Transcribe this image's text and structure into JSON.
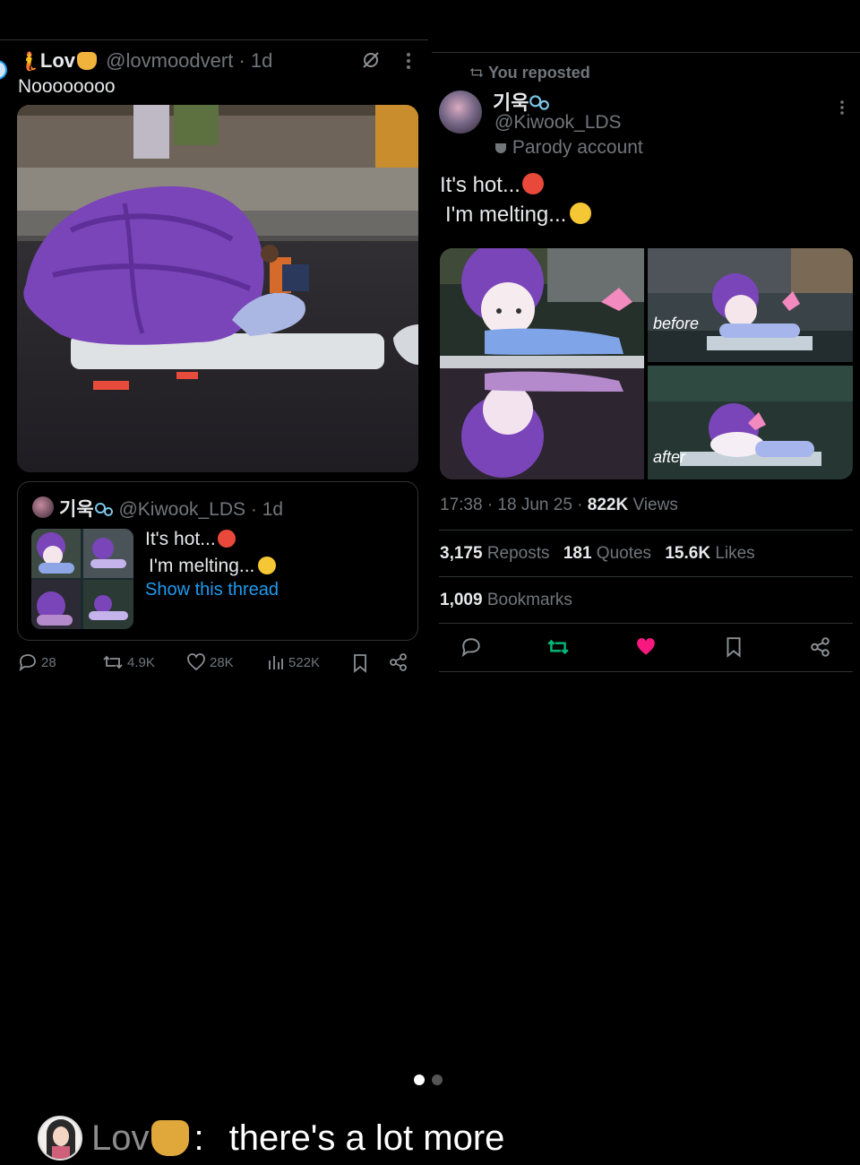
{
  "left_tweet": {
    "display_name": "Lov",
    "handle": "@lovmoodvert",
    "time": "1d",
    "text": "Noooooooo",
    "quote": {
      "display_name": "기욱",
      "handle": "@Kiwook_LDS",
      "time": "1d",
      "line1": "It's hot...",
      "line2": "I'm melting...",
      "show_thread": "Show this thread"
    },
    "stats": {
      "replies": "28",
      "reposts": "4.9K",
      "likes": "28K",
      "views": "522K"
    }
  },
  "right_tweet": {
    "reposted_label": "You reposted",
    "display_name": "기욱",
    "handle": "@Kiwook_LDS",
    "parody_label": "Parody account",
    "line1": "It's hot...",
    "line2": "I'm melting...",
    "image_labels": {
      "before": "before",
      "after": "after"
    },
    "timestamp": "17:38 · 18 Jun 25 · ",
    "views_value": "822K",
    "views_label": "Views",
    "reposts_value": "3,175",
    "reposts_label": "Reposts",
    "quotes_value": "181",
    "quotes_label": "Quotes",
    "likes_value": "15.6K",
    "likes_label": "Likes",
    "bookmarks_value": "1,009",
    "bookmarks_label": "Bookmarks"
  },
  "caption": {
    "name": "Lov",
    "sep": ":",
    "text": "there's a lot more"
  },
  "pager": {
    "current_page": 1,
    "total_pages": 2
  },
  "colors": {
    "bg": "#000000",
    "text": "#e7e9ea",
    "muted": "#71767b",
    "link": "#1d9bf0",
    "repost_active": "#00ba7c",
    "like_active": "#f91880",
    "inflatable_purple": "#7a45b8"
  },
  "icons": [
    "mermaid-emoji-icon",
    "cat-emoji-icon",
    "grok-icon",
    "more-icon",
    "bubbles-emoji-icon",
    "hot-face-emoji-icon",
    "melting-face-emoji-icon",
    "repost-icon",
    "mask-icon",
    "reply-icon",
    "like-icon",
    "views-icon",
    "bookmark-icon",
    "share-icon"
  ]
}
